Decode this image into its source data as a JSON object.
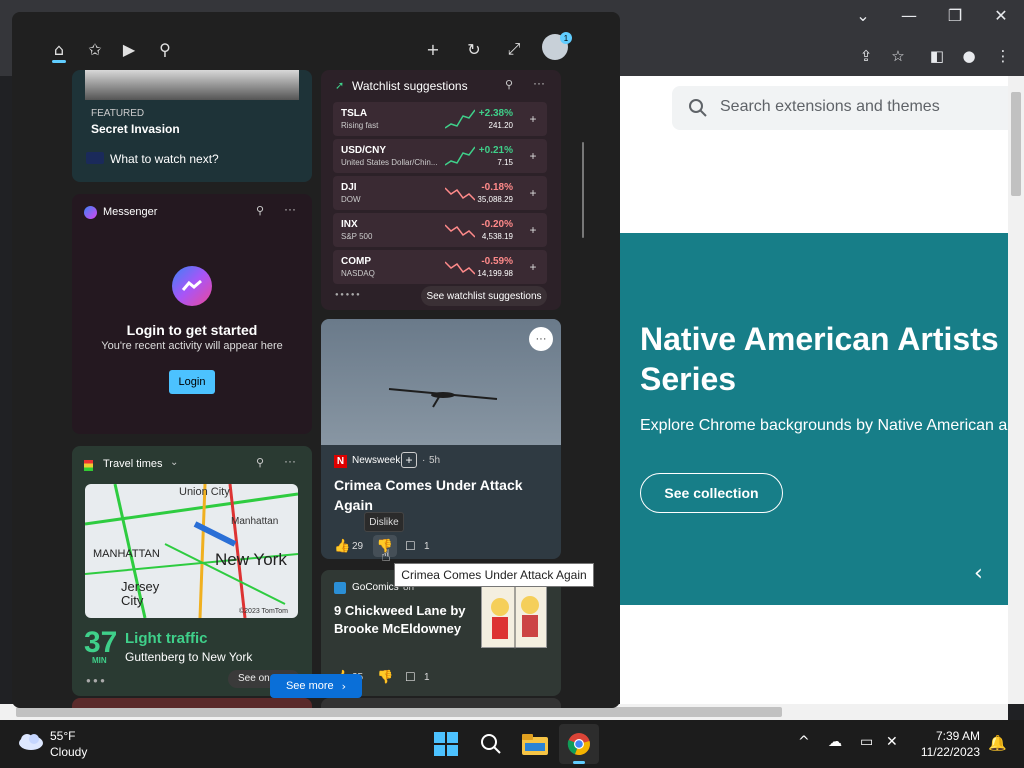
{
  "browser": {
    "window_controls": {
      "minimize": "⌄",
      "min": "—",
      "restore": "❐",
      "close": "✕"
    },
    "toolbar_icons": [
      "share-icon",
      "star-icon",
      "sidebar-icon",
      "profile-icon",
      "menu-icon"
    ],
    "search": {
      "placeholder": "Search extensions and themes"
    },
    "hero": {
      "title": "Native American Artists Series",
      "subtitle": "Explore Chrome backgrounds by Native American a",
      "button": "See collection",
      "color": "#177e88"
    }
  },
  "widgets": {
    "top_icons": [
      "home-icon",
      "favorites-icon",
      "video-icon",
      "family-icon",
      "add-icon",
      "refresh-icon",
      "expand-icon",
      "account-icon"
    ],
    "badge": "1",
    "featured": {
      "label": "FEATURED",
      "title": "Secret Invasion",
      "what_next": "What to watch next?"
    },
    "messenger": {
      "title": "Messenger",
      "heading": "Login to get started",
      "subtext": "You're recent activity will appear here",
      "button": "Login"
    },
    "watchlist": {
      "title": "Watchlist suggestions",
      "stocks": [
        {
          "symbol": "TSLA",
          "name": "Rising fast",
          "change": "+2.38%",
          "price": "241.20",
          "up": true
        },
        {
          "symbol": "USD/CNY",
          "name": "United States Dollar/Chin...",
          "change": "+0.21%",
          "price": "7.15",
          "up": true
        },
        {
          "symbol": "DJI",
          "name": "DOW",
          "change": "-0.18%",
          "price": "35,088.29",
          "up": false
        },
        {
          "symbol": "INX",
          "name": "S&P 500",
          "change": "-0.20%",
          "price": "4,538.19",
          "up": false
        },
        {
          "symbol": "COMP",
          "name": "NASDAQ",
          "change": "-0.59%",
          "price": "14,199.98",
          "up": false
        }
      ],
      "footer_button": "See watchlist suggestions"
    },
    "news": {
      "source": "Newsweek",
      "time": "5h",
      "title": "Crimea Comes Under Attack Again",
      "likes": "29",
      "comments": "1",
      "dislike_tooltip": "Dislike",
      "title_tooltip": "Crimea Comes Under Attack Again"
    },
    "travel": {
      "title": "Travel times",
      "minutes": "37",
      "min_label": "MIN",
      "status": "Light traffic",
      "route": "Guttenberg to New York",
      "see_on": "See on",
      "map_labels": [
        "Union City",
        "Manhattan",
        "MANHATTAN",
        "New York",
        "Jersey City"
      ],
      "copyright": "©2023 TomTom"
    },
    "comics": {
      "source": "GoComics",
      "time": "8h",
      "title": "9 Chickweed Lane by Brooke McEldowney",
      "likes": "25",
      "comments": "1"
    },
    "see_more": "See more"
  },
  "taskbar": {
    "temperature": "55°F",
    "condition": "Cloudy",
    "time": "7:39 AM",
    "date": "11/22/2023"
  }
}
